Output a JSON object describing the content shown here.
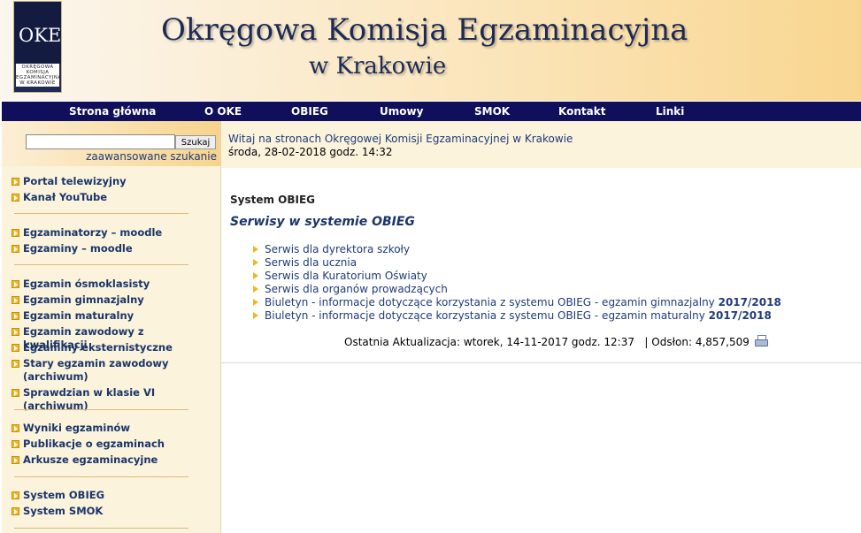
{
  "header": {
    "title": "Okręgowa Komisja Egzaminacyjna",
    "subtitle": "w Krakowie",
    "logo_mark": "OKE",
    "logo_text": [
      "OKRĘGOWA",
      "KOMISJA",
      "EGZAMINACYJNA",
      "W KRAKOWIE"
    ]
  },
  "nav": {
    "items": [
      "Strona główna",
      "O OKE",
      "OBIEG",
      "Umowy",
      "SMOK",
      "Kontakt",
      "Linki"
    ]
  },
  "search": {
    "value": "",
    "button_label": "Szukaj",
    "advanced_label": "zaawansowane szukanie"
  },
  "sidebar": {
    "groups": [
      [
        "Portal telewizyjny",
        "Kanał YouTube"
      ],
      [
        "Egzaminatorzy – moodle",
        "Egzaminy – moodle"
      ],
      [
        "Egzamin ósmoklasisty",
        "Egzamin gimnazjalny",
        "Egzamin maturalny",
        "Egzamin zawodowy z kwalifikacji",
        "Egzaminy eksternistyczne",
        "Stary egzamin zawodowy (archiwum)",
        "Sprawdzian w klasie VI (archiwum)"
      ],
      [
        "Wyniki egzaminów",
        "Publikacje o egzaminach",
        "Arkusze egzaminacyjne"
      ],
      [
        "System OBIEG",
        "System SMOK"
      ]
    ]
  },
  "welcome": {
    "line1": "Witaj na stronach Okręgowej Komisji Egzaminacyjnej w Krakowie",
    "line2": "środa, 28-02-2018 godz. 14:32"
  },
  "main": {
    "section_title": "System OBIEG",
    "heading": "Serwisy w systemie OBIEG",
    "links": [
      {
        "text": "Serwis dla dyrektora szkoły",
        "year": ""
      },
      {
        "text": "Serwis dla ucznia",
        "year": ""
      },
      {
        "text": "Serwis dla Kuratorium Oświaty",
        "year": ""
      },
      {
        "text": "Serwis dla organów prowadzących",
        "year": ""
      },
      {
        "text": "Biuletyn - informacje dotyczące korzystania z systemu OBIEG - egzamin gimnazjalny ",
        "year": "2017/2018"
      },
      {
        "text": "Biuletyn - informacje dotyczące korzystania z systemu OBIEG - egzamin maturalny ",
        "year": "2017/2018"
      }
    ],
    "footer": "Ostatnia Aktualizacja: wtorek, 14-11-2017 godz. 12:37   | Odsłon: 4,857,509"
  },
  "colors": {
    "nav_bg": "#0f0f5c",
    "link": "#1f3b7a",
    "accent": "#f1b722",
    "sidebar_bg": "#fbf3dc"
  },
  "icons": {
    "menu_bullet": "orange-arrow-icon",
    "link_bullet": "orange-triangle-icon",
    "print": "printer-icon"
  }
}
